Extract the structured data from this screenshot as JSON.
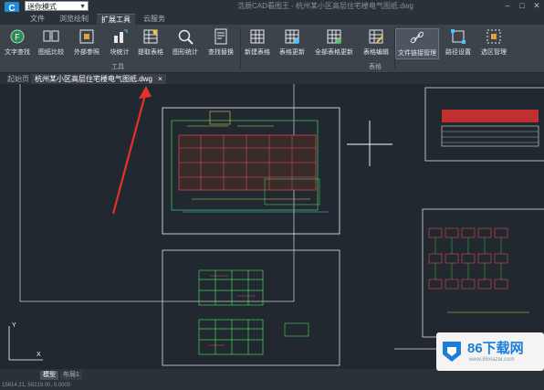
{
  "app": {
    "mode_select": "迷你模式",
    "title": "浩辰CAD看图王 - 杭州某小区高层住宅楼电气图纸.dwg"
  },
  "ribbon_tabs": [
    "文件",
    "浏览绘制",
    "扩展工具",
    "云服务"
  ],
  "tools": [
    {
      "label": "文字查找",
      "icon": "text-find-icon"
    },
    {
      "label": "图纸比较",
      "icon": "drawing-compare-icon"
    },
    {
      "label": "外部参照",
      "icon": "external-reference-icon"
    },
    {
      "label": "块统计",
      "icon": "block-statistics-icon"
    },
    {
      "label": "提取表格",
      "icon": "extract-table-icon"
    },
    {
      "label": "图形统计",
      "icon": "graphic-statistics-icon"
    },
    {
      "label": "查找替换",
      "icon": "find-replace-icon"
    },
    {
      "label": "新建表格",
      "icon": "new-table-icon"
    },
    {
      "label": "表格更新",
      "icon": "table-update-icon"
    },
    {
      "label": "全部表格更新",
      "icon": "update-all-tables-icon"
    },
    {
      "label": "表格编辑",
      "icon": "table-edit-icon"
    },
    {
      "label": "文件链接管理",
      "icon": "file-link-icon"
    },
    {
      "label": "路径设置",
      "icon": "path-settings-icon"
    },
    {
      "label": "选区管理",
      "icon": "selection-manager-icon"
    }
  ],
  "groups": {
    "tools": "工具",
    "table": "表格"
  },
  "doc_tabs": {
    "home": "起始页",
    "drawing": "杭州某小区高层住宅楼电气图纸.dwg"
  },
  "layout_tabs": [
    "模型",
    "布局1"
  ],
  "status": {
    "coords": "15614.21, 58219.00, 0.0000"
  },
  "watermark": {
    "name": "86下载网",
    "url": "www.86xiazai.com"
  },
  "colors": {
    "canvas": "#212830",
    "ribbon": "#3c434b",
    "accent": "#1f8dd6"
  }
}
